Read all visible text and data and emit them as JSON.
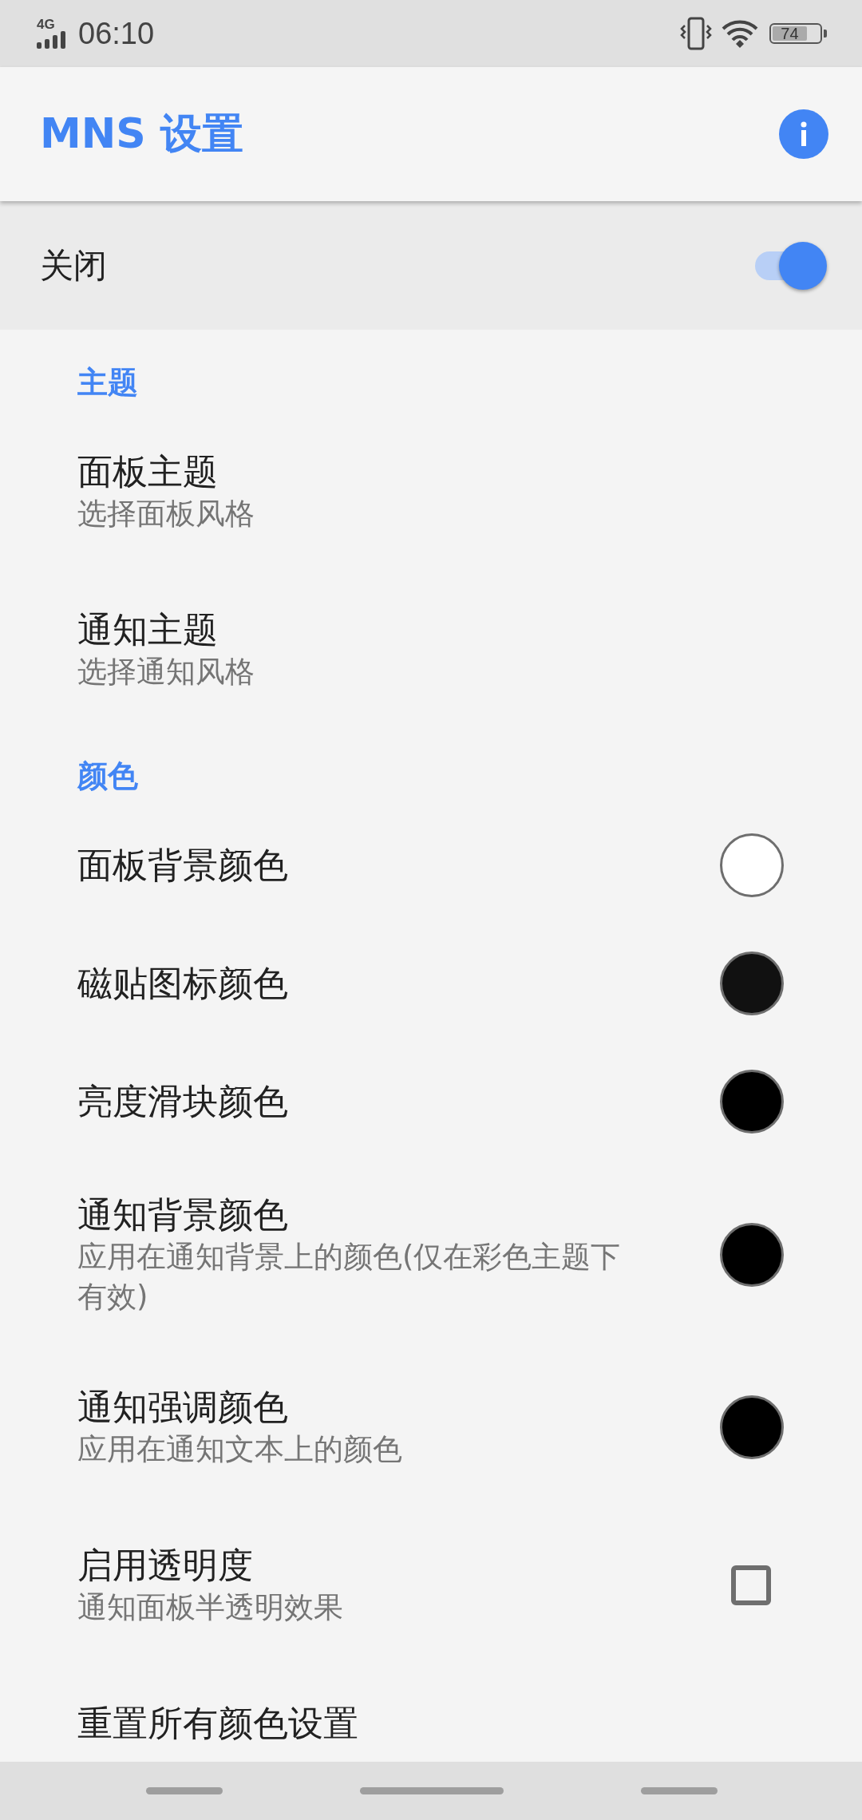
{
  "status_bar": {
    "network": "4G",
    "time": "06:10",
    "battery": "74"
  },
  "app_bar": {
    "title": "MNS 设置"
  },
  "master_switch": {
    "label": "关闭",
    "on": true
  },
  "sections": [
    {
      "title": "主题",
      "items": [
        {
          "kind": "text",
          "title": "面板主题",
          "subtitle": "选择面板风格"
        },
        {
          "kind": "text",
          "title": "通知主题",
          "subtitle": "选择通知风格"
        }
      ]
    },
    {
      "title": "颜色",
      "items": [
        {
          "kind": "color",
          "title": "面板背景颜色",
          "color": "#ffffff"
        },
        {
          "kind": "color",
          "title": "磁贴图标颜色",
          "color": "#111111"
        },
        {
          "kind": "color",
          "title": "亮度滑块颜色",
          "color": "#000000"
        },
        {
          "kind": "color",
          "title": "通知背景颜色",
          "subtitle": "应用在通知背景上的颜色(仅在彩色主题下有效)",
          "color": "#000000"
        },
        {
          "kind": "color",
          "title": "通知强调颜色",
          "subtitle": "应用在通知文本上的颜色",
          "color": "#000000"
        },
        {
          "kind": "checkbox",
          "title": "启用透明度",
          "subtitle": "通知面板半透明效果",
          "checked": false
        },
        {
          "kind": "text",
          "title": "重置所有颜色设置"
        }
      ]
    }
  ]
}
